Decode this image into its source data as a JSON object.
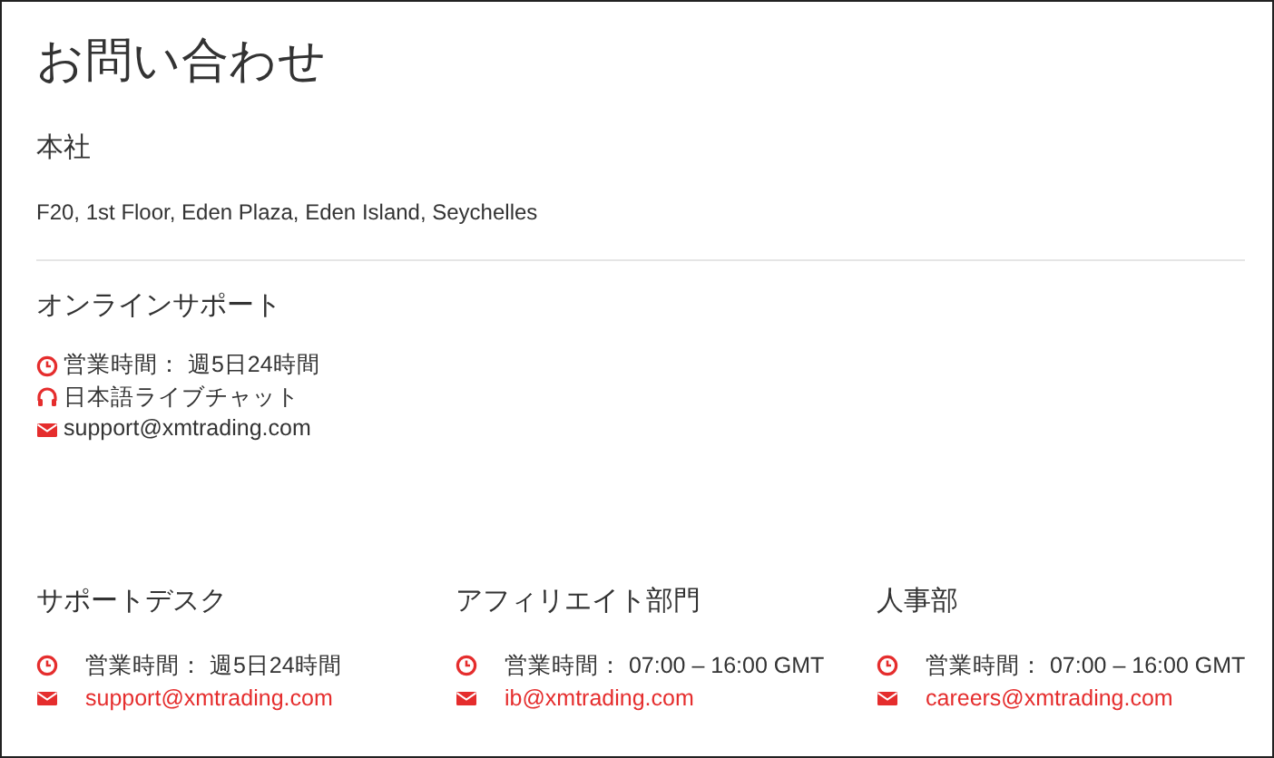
{
  "title": "お問い合わせ",
  "head_office": {
    "heading": "本社",
    "address": "F20, 1st Floor, Eden Plaza, Eden Island, Seychelles"
  },
  "online_support": {
    "heading": "オンラインサポート",
    "lines": [
      {
        "kind": "hours",
        "text": "営業時間： 週5日24時間",
        "link": false
      },
      {
        "kind": "chat",
        "text": "日本語ライブチャット",
        "link": false
      },
      {
        "kind": "email",
        "text": "support@xmtrading.com",
        "link": false
      }
    ]
  },
  "desks": [
    {
      "heading": "サポートデスク",
      "lines": [
        {
          "kind": "hours",
          "text": "営業時間： 週5日24時間",
          "link": false
        },
        {
          "kind": "email",
          "text": "support@xmtrading.com",
          "link": true
        }
      ]
    },
    {
      "heading": "アフィリエイト部門",
      "lines": [
        {
          "kind": "hours",
          "text": "営業時間： 07:00 – 16:00 GMT",
          "link": false
        },
        {
          "kind": "email",
          "text": "ib@xmtrading.com",
          "link": true
        }
      ]
    },
    {
      "heading": "人事部",
      "lines": [
        {
          "kind": "hours",
          "text": "営業時間： 07:00 – 16:00 GMT",
          "link": false
        },
        {
          "kind": "email",
          "text": "careers@xmtrading.com",
          "link": true
        }
      ]
    }
  ]
}
